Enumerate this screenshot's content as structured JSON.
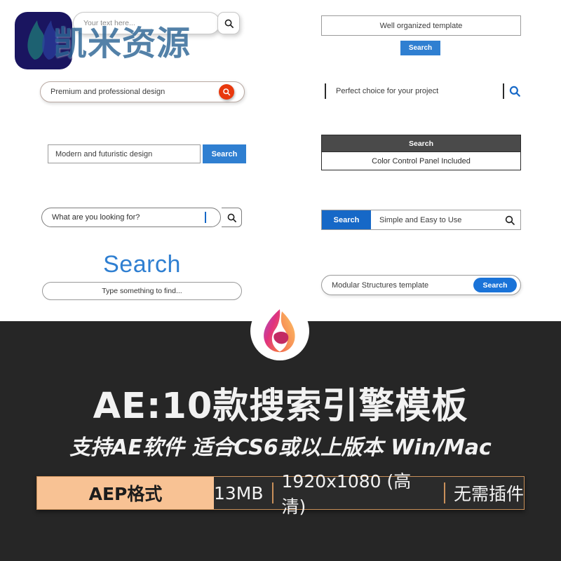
{
  "showcase": {
    "widgets": [
      {
        "id": "rounded-pill-with-detached-button",
        "placeholder": "Your text here...",
        "icon": "search-icon"
      },
      {
        "id": "pill-with-red-circle-button",
        "value": "Premium and professional design",
        "icon": "search-icon",
        "accent": "#e8380d"
      },
      {
        "id": "rect-with-blue-search-button",
        "value": "Modern and futuristic design",
        "button_label": "Search",
        "accent": "#2f7fd1"
      },
      {
        "id": "pill-with-divider-and-magnifier",
        "value": "What are you looking for?",
        "icon": "search-icon",
        "accent": "#1668c7"
      },
      {
        "id": "heading-over-pill",
        "heading": "Search",
        "placeholder": "Type something to find...",
        "accent": "#2f7fd1"
      },
      {
        "id": "rect-with-button-below",
        "value": "Well organized template",
        "button_label": "Search",
        "accent": "#2f7fd1"
      },
      {
        "id": "borderless-with-blue-icon",
        "value": "Perfect choice for your project",
        "icon": "search-icon",
        "accent": "#1668c7"
      },
      {
        "id": "dark-header-table",
        "header": "Search",
        "value": "Color Control Panel Included",
        "accent": "#4a4a4a"
      },
      {
        "id": "left-button-bar",
        "button_label": "Search",
        "value": "Simple and Easy to Use",
        "icon": "search-icon",
        "accent": "#1668c7"
      },
      {
        "id": "pill-with-inner-pill-button",
        "value": "Modular Structures template",
        "button_label": "Search",
        "accent": "#1a73d8"
      }
    ]
  },
  "watermark": {
    "text": "凯米资源",
    "logo_icon": "flame-logo-icon"
  },
  "banner": {
    "logo_icon": "flame-circle-icon",
    "title": "AE:10款搜索引擎模板",
    "subtitle": "支持AE软件 适合CS6或以上版本 Win/Mac",
    "spec": {
      "format": "AEP格式",
      "size": "13MB",
      "resolution": "1920x1080 (高清)",
      "plugin": "无需插件"
    },
    "colors": {
      "background": "#262626",
      "badge": "#f8c294",
      "badge_border": "#c9905a"
    }
  }
}
